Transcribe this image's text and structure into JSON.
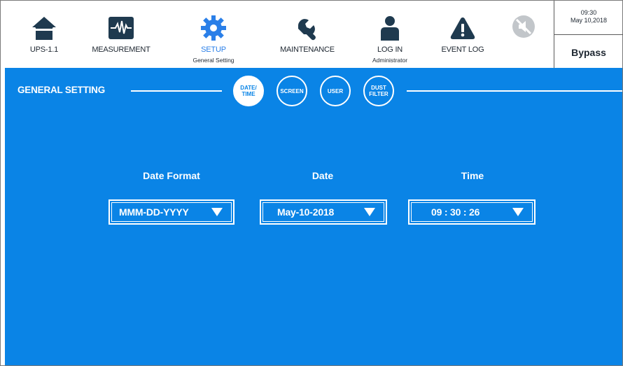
{
  "nav": [
    {
      "id": "ups",
      "label": "UPS-1.1",
      "sub": "",
      "icon": "home-icon"
    },
    {
      "id": "measurement",
      "label": "MEASUREMENT",
      "sub": "",
      "icon": "waveform-icon"
    },
    {
      "id": "setup",
      "label": "SETUP",
      "sub": "General Setting",
      "icon": "gear-icon",
      "active": true
    },
    {
      "id": "maintenance",
      "label": "MAINTENANCE",
      "sub": "",
      "icon": "wrench-icon"
    },
    {
      "id": "login",
      "label": "LOG IN",
      "sub": "Administrator",
      "icon": "user-icon"
    },
    {
      "id": "eventlog",
      "label": "EVENT LOG",
      "sub": "",
      "icon": "warning-icon"
    }
  ],
  "mute_icon": "mute-icon",
  "status": {
    "time": "09:30",
    "date": "May 10,2018",
    "mode": "Bypass"
  },
  "section": {
    "title": "GENERAL SETTING"
  },
  "tabs": [
    {
      "line1": "DATE/",
      "line2": "TIME",
      "active": true
    },
    {
      "line1": "SCREEN",
      "line2": ""
    },
    {
      "line1": "USER",
      "line2": ""
    },
    {
      "line1": "DUST",
      "line2": "FILTER"
    }
  ],
  "fields": {
    "date_format": {
      "label": "Date Format",
      "value": "MMM-DD-YYYY"
    },
    "date": {
      "label": "Date",
      "value": "May-10-2018"
    },
    "time": {
      "label": "Time",
      "value": "09 : 30 : 26"
    }
  },
  "colors": {
    "accent": "#0a84e6",
    "active_text": "#2a7fe8",
    "icon_dark": "#1f3a4f"
  }
}
